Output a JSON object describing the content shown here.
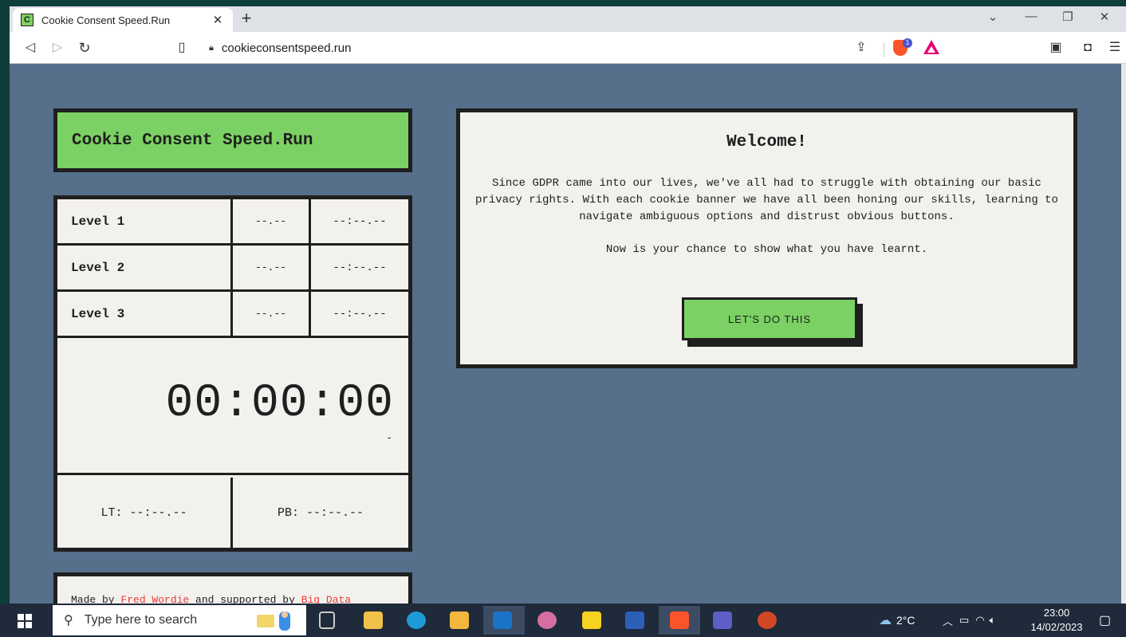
{
  "browser": {
    "tab_title": "Cookie Consent Speed.Run",
    "favicon_letter": "C",
    "url": "cookieconsentspeed.run",
    "brave_badge": "1"
  },
  "page": {
    "title": "Cookie Consent Speed.Run",
    "levels": [
      {
        "name": "Level 1",
        "split": "--.--",
        "time": "--:--.--"
      },
      {
        "name": "Level 2",
        "split": "--.--",
        "time": "--:--.--"
      },
      {
        "name": "Level 3",
        "split": "--.--",
        "time": "--:--.--"
      }
    ],
    "clock": "00:00:00",
    "clock_sub": "-",
    "lt": "LT: --:--.--",
    "pb": "PB: --:--.--",
    "footer": {
      "prefix": "Made by ",
      "author": "Fred Wordie",
      "middle": " and supported by ",
      "sponsor": "Big Data"
    },
    "welcome": {
      "title": "Welcome!",
      "text": "Since GDPR came into our lives, we've all had to struggle with obtaining our basic privacy rights. With each cookie banner we have all been honing our skills, learning to navigate ambiguous options and distrust obvious buttons.",
      "text2": "Now is your chance to show what you have learnt.",
      "cta": "LET'S DO THIS"
    }
  },
  "taskbar": {
    "search_placeholder": "Type here to search",
    "weather": "2°C",
    "time": "23:00",
    "date": "14/02/2023"
  },
  "colors": {
    "page_bg": "#566f8b",
    "accent_green": "#7bd163",
    "panel_bg": "#f3f1ee",
    "border": "#1f1f1f",
    "link_red": "#e83b3b"
  }
}
